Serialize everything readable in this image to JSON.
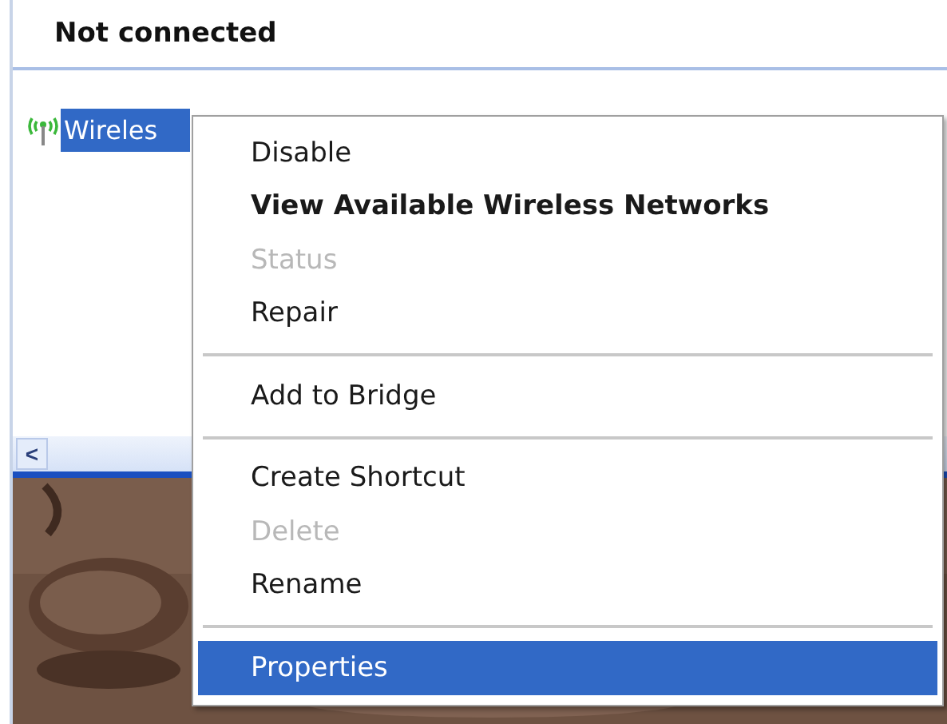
{
  "group_header": {
    "title": "Not connected"
  },
  "connection": {
    "label": "Wireles",
    "selected": true
  },
  "scrollbar": {
    "left_arrow": "<"
  },
  "context_menu": [
    {
      "kind": "item",
      "label": "Disable",
      "bold": false,
      "disabled": false,
      "selected": false
    },
    {
      "kind": "item",
      "label": "View Available Wireless Networks",
      "bold": true,
      "disabled": false,
      "selected": false
    },
    {
      "kind": "item",
      "label": "Status",
      "bold": false,
      "disabled": true,
      "selected": false
    },
    {
      "kind": "item",
      "label": "Repair",
      "bold": false,
      "disabled": false,
      "selected": false
    },
    {
      "kind": "separator"
    },
    {
      "kind": "item",
      "label": "Add to Bridge",
      "bold": false,
      "disabled": false,
      "selected": false
    },
    {
      "kind": "separator"
    },
    {
      "kind": "item",
      "label": "Create Shortcut",
      "bold": false,
      "disabled": false,
      "selected": false
    },
    {
      "kind": "item",
      "label": "Delete",
      "bold": false,
      "disabled": true,
      "selected": false
    },
    {
      "kind": "item",
      "label": "Rename",
      "bold": false,
      "disabled": false,
      "selected": false
    },
    {
      "kind": "separator"
    },
    {
      "kind": "item",
      "label": "Properties",
      "bold": false,
      "disabled": false,
      "selected": true
    }
  ]
}
